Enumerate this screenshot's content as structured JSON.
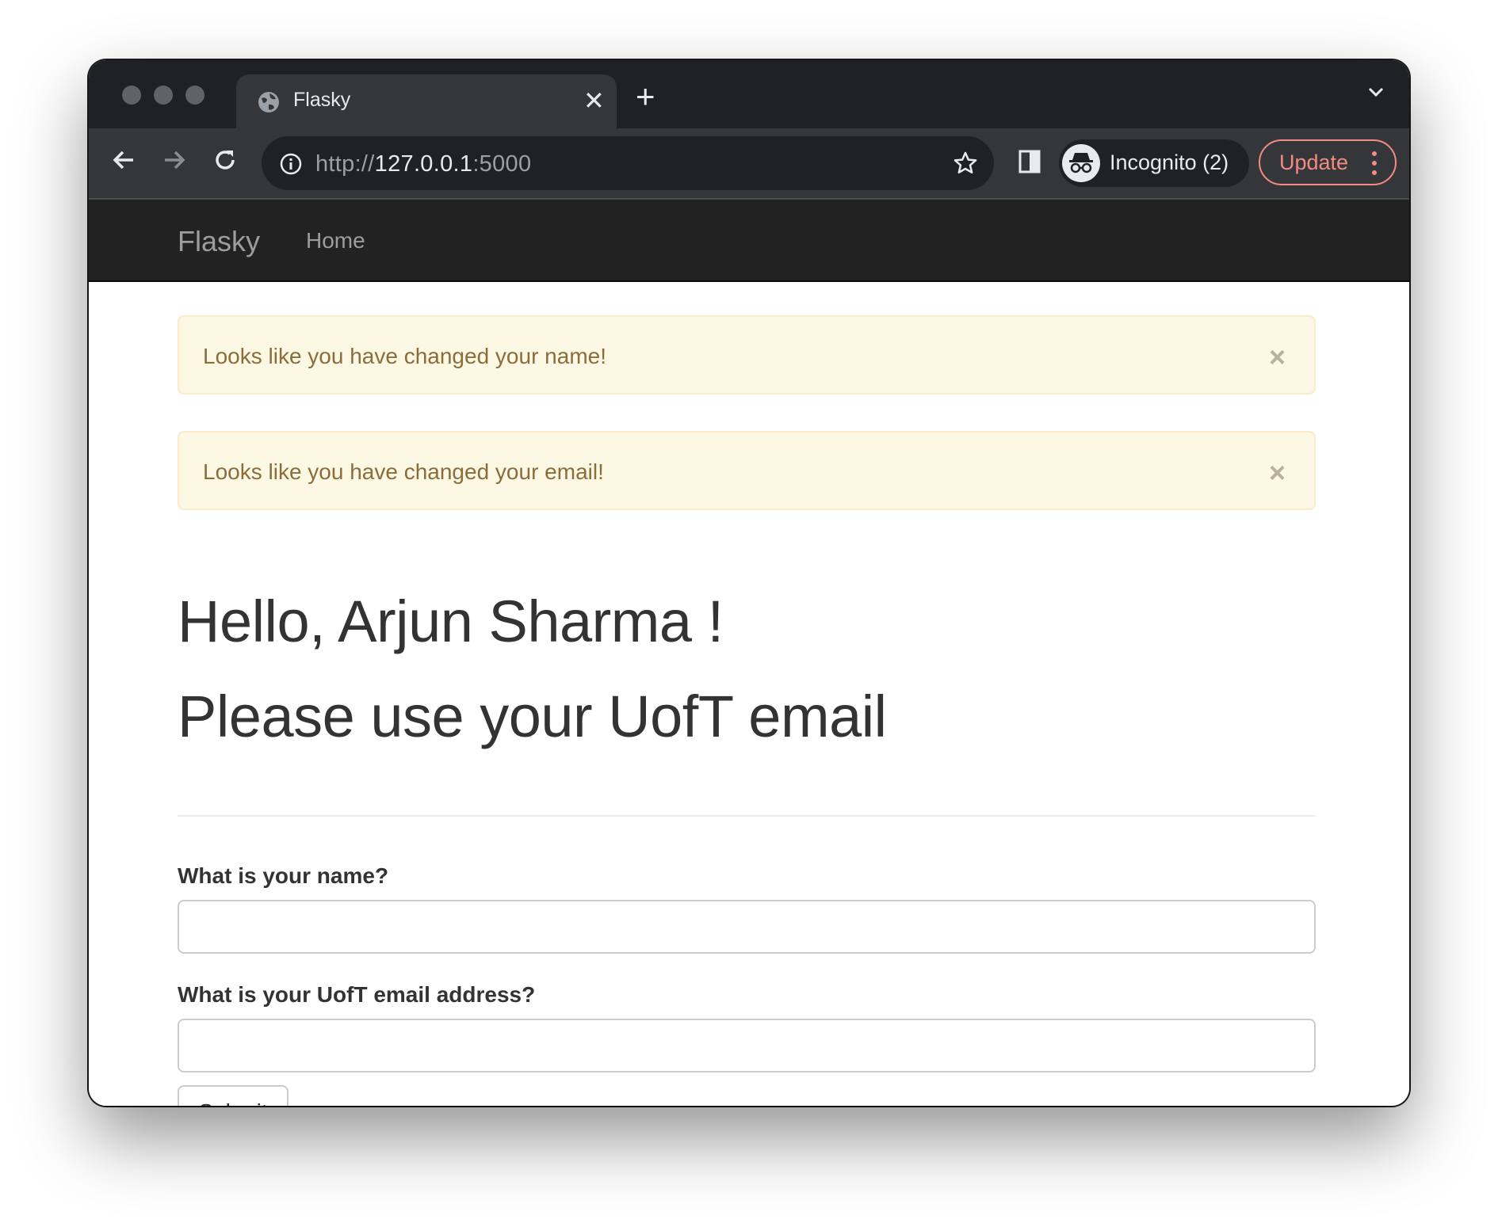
{
  "browser": {
    "tab_title": "Flasky",
    "url_scheme": "http://",
    "url_host": "127.0.0.1",
    "url_port": ":5000",
    "profile_label": "Incognito (2)",
    "update_label": "Update"
  },
  "navbar": {
    "brand": "Flasky",
    "links": [
      "Home"
    ]
  },
  "alerts": [
    {
      "message": "Looks like you have changed your name!",
      "close": "×"
    },
    {
      "message": "Looks like you have changed your email!",
      "close": "×"
    }
  ],
  "heading": {
    "greeting": "Hello, Arjun Sharma !",
    "subtitle": "Please use your UofT email"
  },
  "form": {
    "name_label": "What is your name?",
    "name_value": "",
    "email_label": "What is your UofT email address?",
    "email_value": "",
    "submit_label": "Submit"
  },
  "colors": {
    "navbar_bg": "#222222",
    "alert_bg": "#fcf8e3",
    "alert_text": "#8a6d3b",
    "update_accent": "#f28b82"
  }
}
